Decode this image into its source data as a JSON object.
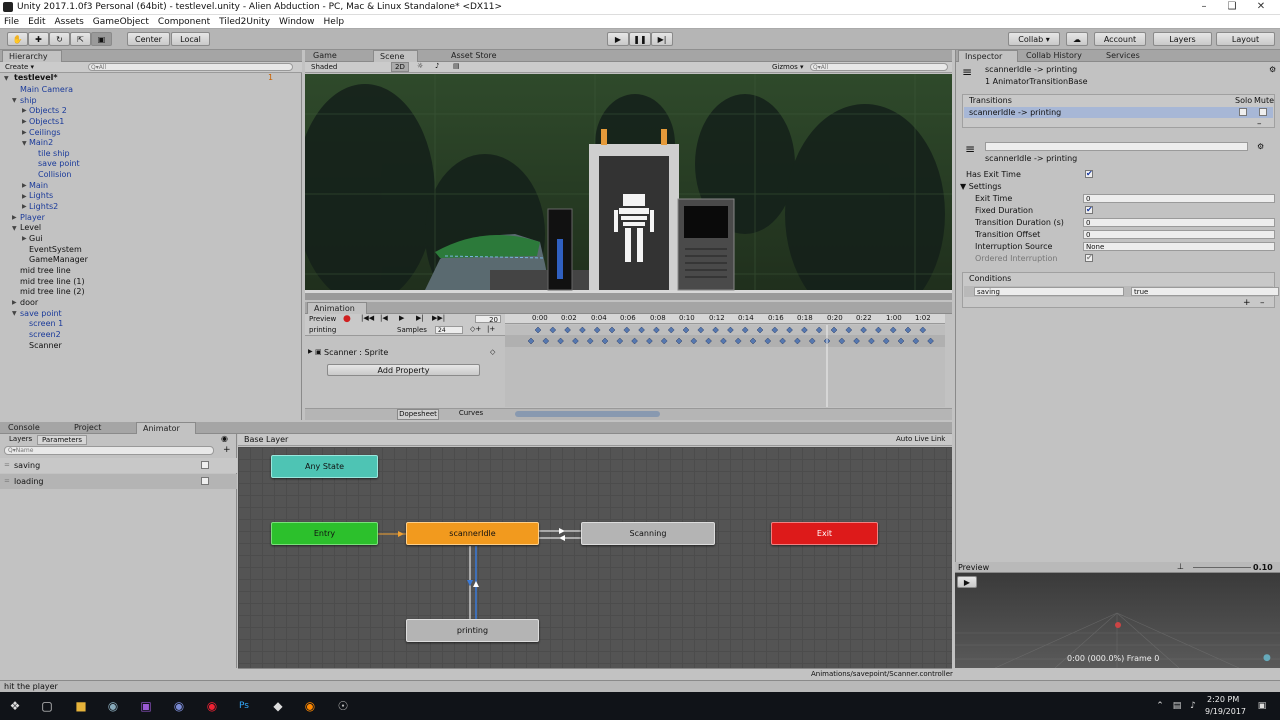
{
  "window": {
    "title": "Unity 2017.1.0f3 Personal (64bit) - testlevel.unity - Alien Abduction - PC, Mac & Linux Standalone* <DX11>"
  },
  "menu": [
    "File",
    "Edit",
    "Assets",
    "GameObject",
    "Component",
    "Tiled2Unity",
    "Window",
    "Help"
  ],
  "toolbar": {
    "center": "Center",
    "local": "Local",
    "collab": "Collab ▾",
    "account": "Account",
    "layers": "Layers",
    "layout": "Layout"
  },
  "hierarchy": {
    "tab": "Hierarchy",
    "create": "Create ▾",
    "search": "Q▾All",
    "scene": "testlevel*",
    "count": "1",
    "items": [
      "Main Camera",
      "ship",
      "Objects 2",
      "Objects1",
      "Ceilings",
      "Main2",
      "tile ship",
      "save point",
      "Collision",
      "Main",
      "Lights",
      "Lights2",
      "Player",
      "Level",
      "Gui",
      "EventSystem",
      "GameManager",
      "mid tree line",
      "mid tree line (1)",
      "mid tree line (2)",
      "door",
      "save point",
      "screen 1",
      "screen2",
      "Scanner"
    ]
  },
  "scene_view": {
    "tabs": [
      "Game",
      "Scene",
      "Asset Store"
    ],
    "shaded": "Shaded",
    "mode2d": "2D",
    "gizmos": "Gizmos ▾",
    "search": "Q▾All"
  },
  "animation": {
    "tab": "Animation",
    "preview": "Preview",
    "clip": "printing",
    "frame": "20",
    "samples_label": "Samples",
    "samples": "24",
    "times": [
      "0:00",
      "0:02",
      "0:04",
      "0:06",
      "0:08",
      "0:10",
      "0:12",
      "0:14",
      "0:16",
      "0:18",
      "0:20",
      "0:22",
      "1:00",
      "1:02"
    ],
    "property": "Scanner : Sprite",
    "add_property": "Add Property",
    "dopesheet": "Dopesheet",
    "curves": "Curves"
  },
  "inspector": {
    "tabs": [
      "Inspector",
      "Collab History",
      "Services"
    ],
    "title": "scannerIdle -> printing",
    "subtitle": "1 AnimatorTransitionBase",
    "transitions_label": "Transitions",
    "solo": "Solo",
    "mute": "Mute",
    "transition_item": "scannerIdle -> printing",
    "transition_name": "scannerIdle -> printing",
    "has_exit_time": "Has Exit Time",
    "settings": "Settings",
    "fields": [
      {
        "label": "Exit Time",
        "value": "0"
      },
      {
        "label": "Fixed Duration",
        "value": "✔"
      },
      {
        "label": "Transition Duration (s)",
        "value": "0"
      },
      {
        "label": "Transition Offset",
        "value": "0"
      },
      {
        "label": "Interruption Source",
        "value": "None"
      },
      {
        "label": "Ordered Interruption",
        "value": "✔"
      }
    ],
    "conditions_label": "Conditions",
    "condition_param": "saving",
    "condition_value": "true"
  },
  "bottom_tabs": [
    "Console",
    "Project",
    "Animator"
  ],
  "animator": {
    "layers_tab": "Layers",
    "params_tab": "Parameters",
    "search": "Q▾Name",
    "base_layer": "Base Layer",
    "auto_live": "Auto Live Link",
    "params": [
      "saving",
      "loading"
    ],
    "nodes": {
      "any": "Any State",
      "entry": "Entry",
      "idle": "scannerIdle",
      "scanning": "Scanning",
      "exit": "Exit",
      "printing": "printing"
    },
    "path": "Animations/savepoint/Scanner.controller"
  },
  "preview": {
    "label": "Preview",
    "speed": "0.10",
    "time": "0:00 (000.0%) Frame 0"
  },
  "status": "hit the player",
  "clock": {
    "time": "2:20 PM",
    "date": "9/19/2017"
  },
  "colors": {
    "any": "#4ec4b4",
    "entry": "#2cc02c",
    "idle": "#f29a1e",
    "exit": "#dd1a1a",
    "state": "#b4b4b4",
    "grid": "#555555",
    "selected_row": "#a7b7d6"
  }
}
